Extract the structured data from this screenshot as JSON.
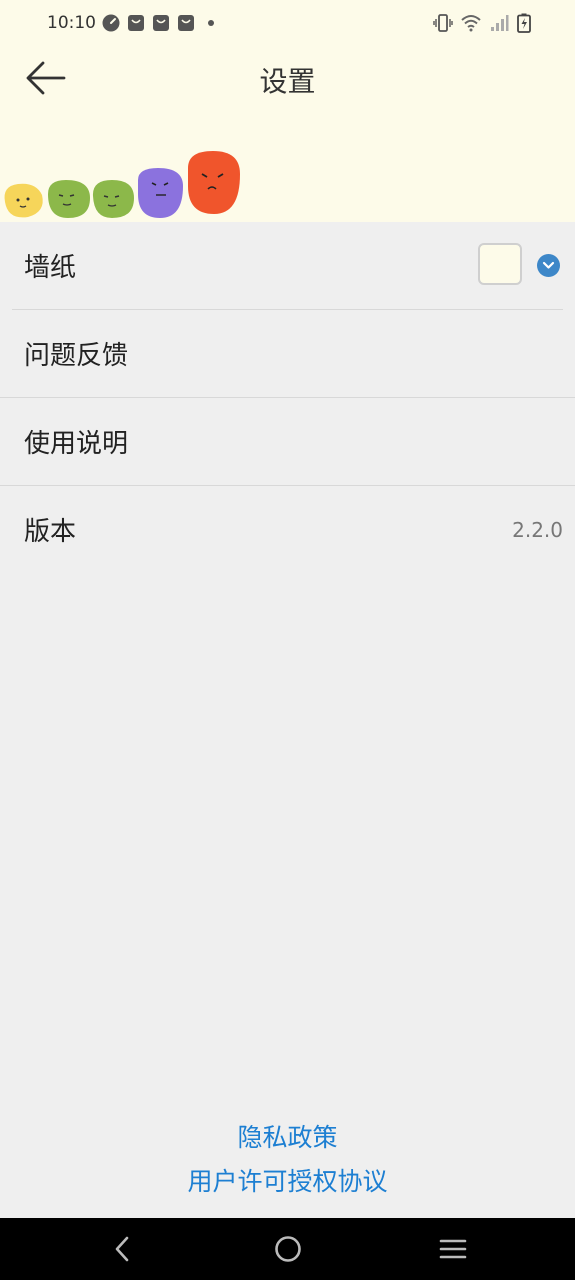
{
  "status_bar": {
    "time": "10:10",
    "left_icons": [
      "speedometer-icon",
      "shopping-bag-icon",
      "shopping-bag-icon",
      "shopping-bag-icon",
      "dot-icon"
    ],
    "right_icons": [
      "vibrate-icon",
      "wifi-icon",
      "signal-icon",
      "battery-charging-icon"
    ]
  },
  "header": {
    "title": "设置",
    "back_icon": "arrow-left-icon",
    "background": "#fdfbe9"
  },
  "mascots": [
    {
      "color": "#f6d55a",
      "mood": "happy"
    },
    {
      "color": "#8cb84a",
      "mood": "happy"
    },
    {
      "color": "#8cb84a",
      "mood": "happy"
    },
    {
      "color": "#8b72de",
      "mood": "neutral"
    },
    {
      "color": "#f0552c",
      "mood": "angry"
    }
  ],
  "settings": {
    "wallpaper_label": "墙纸",
    "wallpaper_color": "#fdfbe9",
    "wallpaper_dropdown_icon": "chevron-down-icon",
    "feedback_label": "问题反馈",
    "instructions_label": "使用说明",
    "version_label": "版本",
    "version_value": "2.2.0"
  },
  "footer_links": {
    "privacy_policy": "隐私政策",
    "user_license": "用户许可授权协议"
  },
  "nav_bar": {
    "buttons": [
      "back-icon",
      "home-icon",
      "menu-icon"
    ]
  },
  "colors": {
    "accent": "#3d87c8",
    "link": "#1d7fd2",
    "list_background": "#efefef"
  }
}
